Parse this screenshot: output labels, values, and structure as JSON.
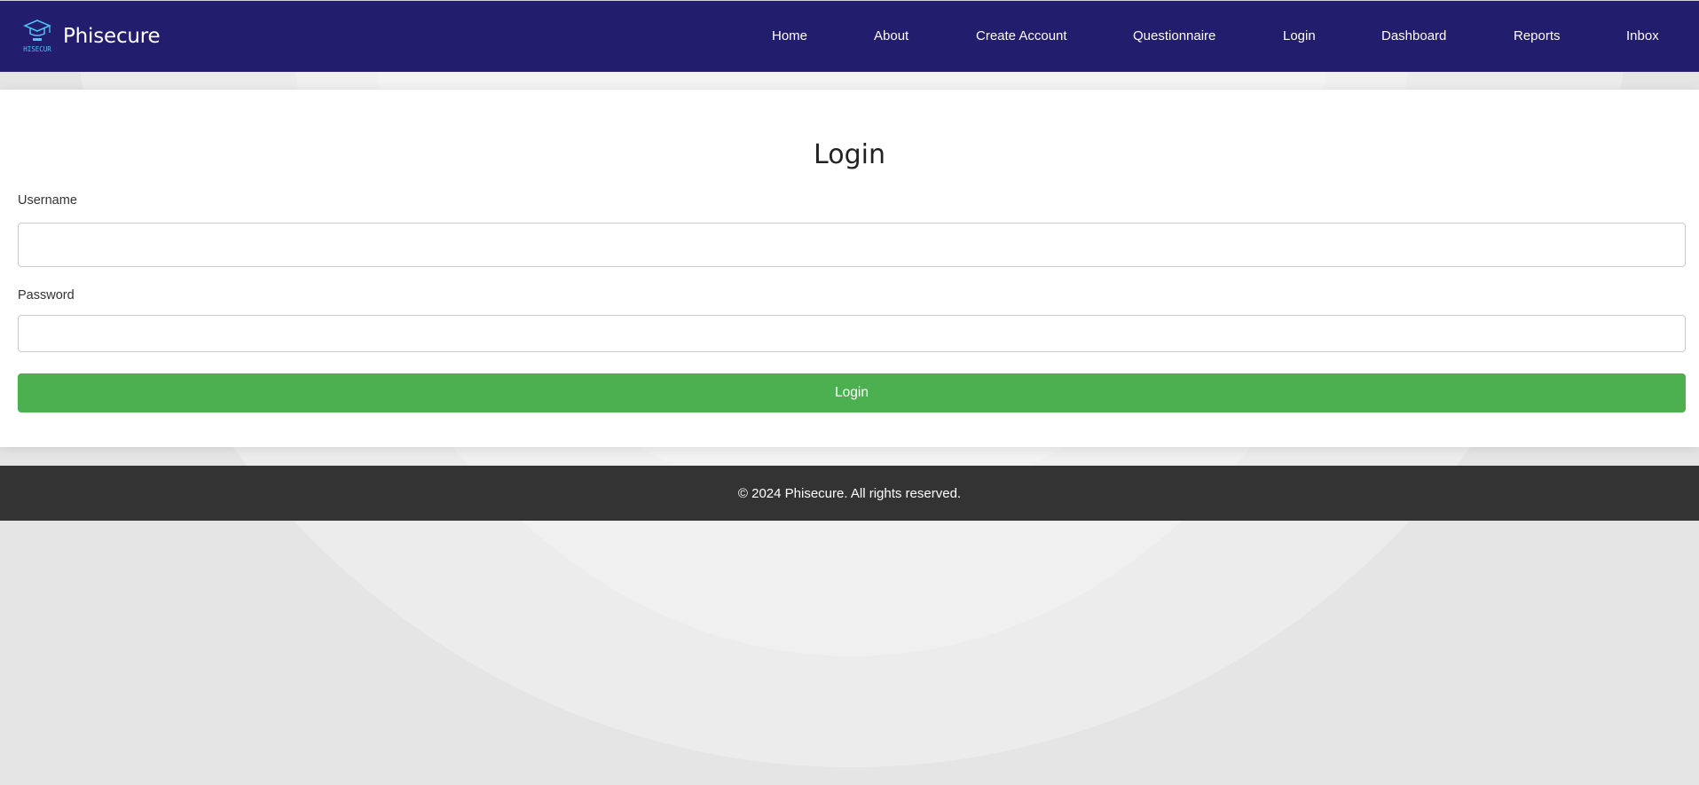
{
  "brand": {
    "name": "Phisecure",
    "logo_text": "PHISECURE",
    "logo_icon": "graduation-cap-icon"
  },
  "nav": {
    "items": [
      {
        "label": "Home"
      },
      {
        "label": "About"
      },
      {
        "label": "Create Account"
      },
      {
        "label": "Questionnaire"
      },
      {
        "label": "Login"
      },
      {
        "label": "Dashboard"
      },
      {
        "label": "Reports"
      },
      {
        "label": "Inbox"
      }
    ]
  },
  "login": {
    "title": "Login",
    "username_label": "Username",
    "username_value": "",
    "password_label": "Password",
    "password_value": "",
    "submit_label": "Login"
  },
  "footer": {
    "text": "© 2024 Phisecure. All rights reserved."
  },
  "colors": {
    "navbar": "#231d6e",
    "button": "#4caf50",
    "footer": "#333333",
    "background": "#e6e6e6"
  }
}
